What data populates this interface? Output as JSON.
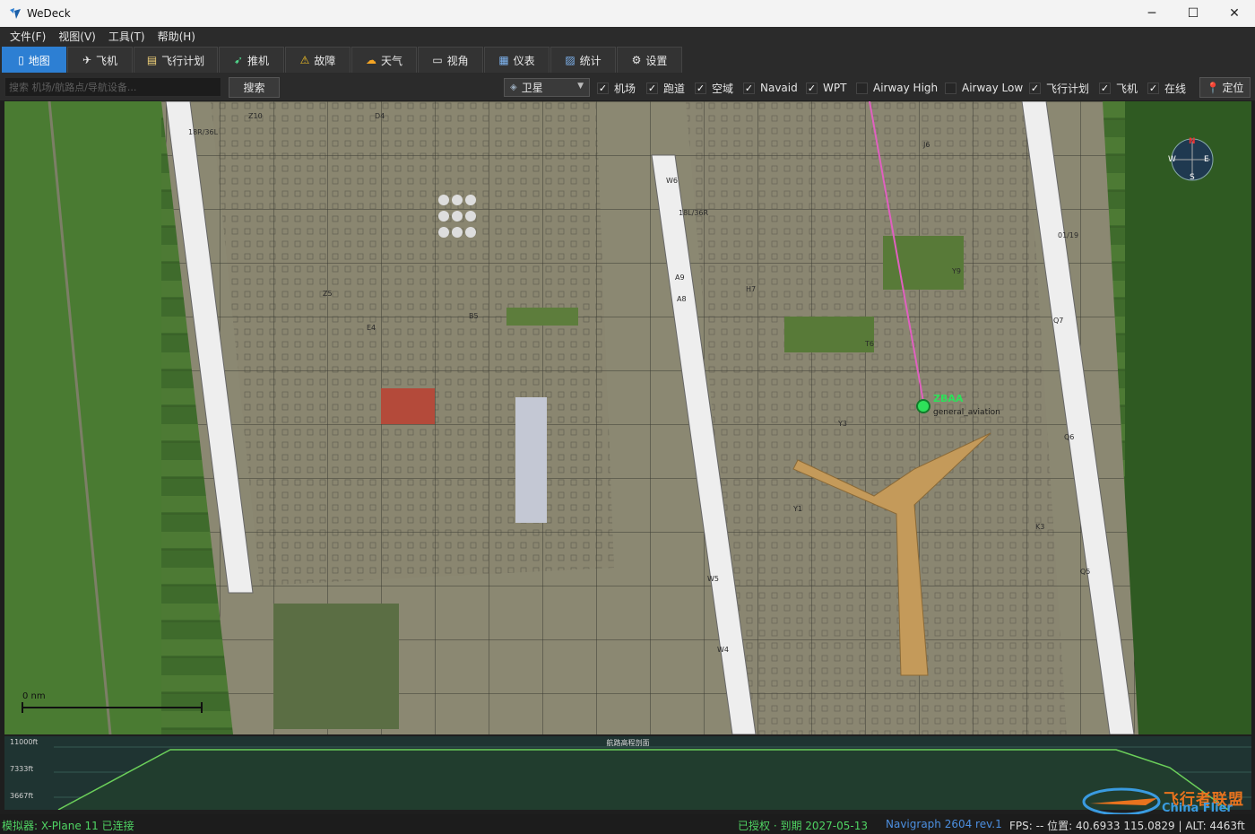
{
  "window": {
    "title": "WeDeck",
    "minimize": "─",
    "maximize": "☐",
    "close": "✕"
  },
  "menu": [
    "文件(F)",
    "视图(V)",
    "工具(T)",
    "帮助(H)"
  ],
  "tabs": [
    {
      "label": "地图",
      "icon": "map-icon",
      "active": true
    },
    {
      "label": "飞机",
      "icon": "plane-icon"
    },
    {
      "label": "飞行计划",
      "icon": "flight-plan-icon"
    },
    {
      "label": "推机",
      "icon": "pushback-icon"
    },
    {
      "label": "故障",
      "icon": "warning-icon"
    },
    {
      "label": "天气",
      "icon": "weather-icon"
    },
    {
      "label": "视角",
      "icon": "camera-view-icon"
    },
    {
      "label": "仪表",
      "icon": "instrument-icon"
    },
    {
      "label": "统计",
      "icon": "stats-icon"
    },
    {
      "label": "设置",
      "icon": "gear-icon"
    }
  ],
  "toolbar": {
    "search_placeholder": "搜索 机场/航路点/导航设备...",
    "search_button": "搜索",
    "layer_value": "卫星",
    "locate_button": "定位",
    "checkboxes": [
      {
        "label": "机场",
        "checked": true
      },
      {
        "label": "跑道",
        "checked": true
      },
      {
        "label": "空域",
        "checked": true
      },
      {
        "label": "Navaid",
        "checked": true
      },
      {
        "label": "WPT",
        "checked": true
      },
      {
        "label": "Airway High",
        "checked": false
      },
      {
        "label": "Airway Low",
        "checked": false
      },
      {
        "label": "飞行计划",
        "checked": true
      },
      {
        "label": "飞机",
        "checked": true
      },
      {
        "label": "在线",
        "checked": true
      }
    ]
  },
  "map": {
    "airport_ident": "ZBAA",
    "airport_type": "general_aviation",
    "compass": {
      "n": "N",
      "s": "S",
      "e": "E",
      "w": "W"
    },
    "scale_label": "0 nm",
    "runway_labels": [
      "18R/36L",
      "18L/36R",
      "01/19"
    ],
    "taxiway_labels": [
      "Z10",
      "D4",
      "Z5",
      "Y3",
      "Y1",
      "W6",
      "W5",
      "W4",
      "Q5",
      "Q6",
      "Q7",
      "K3",
      "T6",
      "J6",
      "Y9",
      "A9",
      "A8",
      "H7",
      "E4",
      "B5"
    ]
  },
  "profile": {
    "title": "航路高程剖面",
    "y_labels": [
      "11000ft",
      "7333ft",
      "3667ft"
    ]
  },
  "status": {
    "simulator": "模拟器: X-Plane 11 已连接",
    "license": "已授权 · 到期 2027-05-13",
    "navdata": "Navigraph 2604 rev.1",
    "telemetry": "FPS: --  位置: 40.6933 115.0829 | ALT: 4463ft"
  },
  "watermark": {
    "cn": "飞行者联盟",
    "en": "China Flier"
  },
  "colors": {
    "accent": "#2d7fd3",
    "status_green": "#4fd463",
    "nav_blue": "#4c8fe0",
    "route_pink": "#e060c0",
    "airport_green": "#2ee05a"
  }
}
